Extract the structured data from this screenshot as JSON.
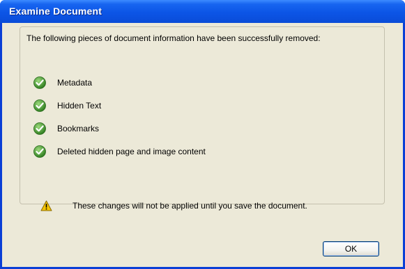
{
  "window": {
    "title": "Examine Document"
  },
  "dialog": {
    "intro": "The following pieces of document information have been successfully removed:",
    "items": [
      {
        "label": "Metadata",
        "icon": "checkmark-icon"
      },
      {
        "label": "Hidden Text",
        "icon": "checkmark-icon"
      },
      {
        "label": "Bookmarks",
        "icon": "checkmark-icon"
      },
      {
        "label": "Deleted hidden page and image content",
        "icon": "checkmark-icon"
      }
    ],
    "warning": {
      "icon": "warning-icon",
      "text": "These changes will not be applied until you save the document."
    },
    "ok_label": "OK"
  },
  "colors": {
    "titlebar": "#0c55e6",
    "client": "#ece9d8",
    "check_green": "#3a8a2a",
    "warning_yellow": "#f5c400"
  }
}
